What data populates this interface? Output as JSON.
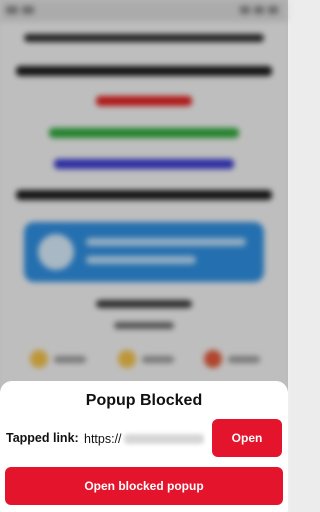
{
  "popup": {
    "title": "Popup Blocked",
    "tapped_link_label": "Tapped link:",
    "link_value_visible": "https://",
    "open_label": "Open",
    "open_blocked_label": "Open blocked popup"
  },
  "colors": {
    "accent": "#e3142b",
    "sheet_background": "#ffffff"
  }
}
